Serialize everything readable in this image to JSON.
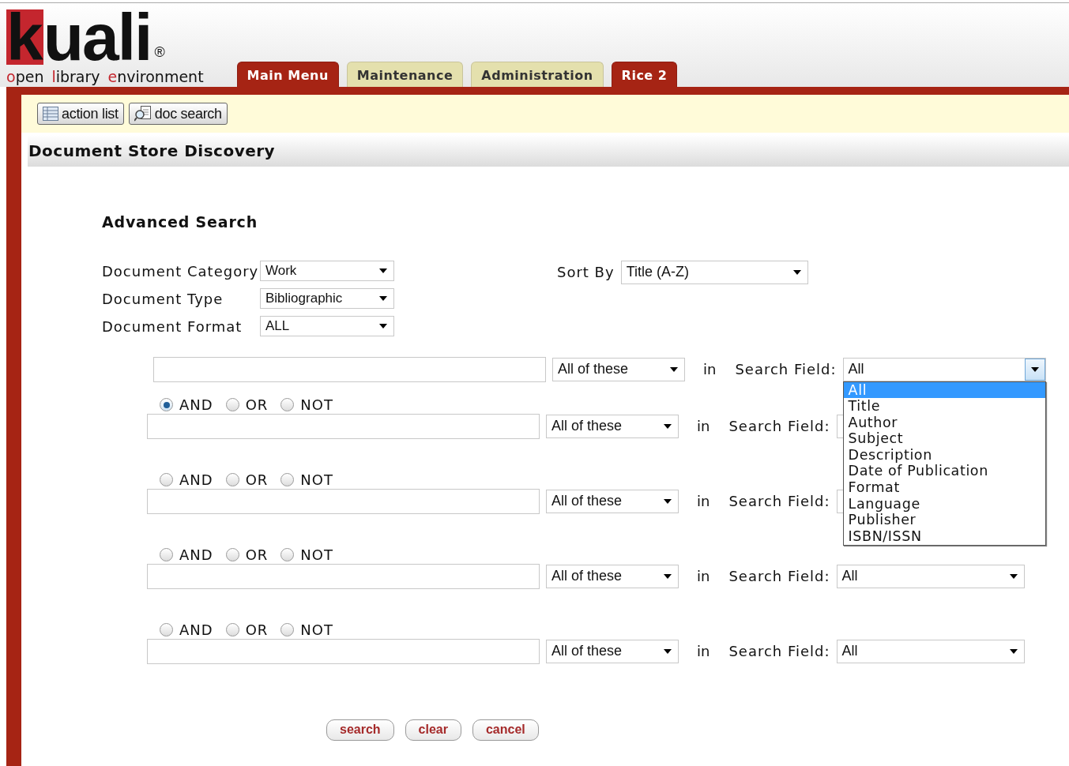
{
  "logo": {
    "text": "kuali",
    "mark": "®",
    "tagline": "open library environment"
  },
  "tabs": [
    {
      "label": "Main Menu",
      "selected": true
    },
    {
      "label": "Maintenance",
      "selected": false
    },
    {
      "label": "Administration",
      "selected": false
    },
    {
      "label": "Rice 2",
      "selected": true
    }
  ],
  "toolbar": [
    {
      "label": "action list",
      "kind": "list"
    },
    {
      "label": "doc search",
      "kind": "search"
    }
  ],
  "page_title": "Document Store Discovery",
  "section_title": "Advanced Search",
  "filters": [
    {
      "label": "Document Category",
      "value": "Work"
    },
    {
      "label": "Document Type",
      "value": "Bibliographic"
    },
    {
      "label": "Document Format",
      "value": "ALL"
    }
  ],
  "sort": {
    "label": "Sort By",
    "value": "Title (A-Z)"
  },
  "rows": [
    {
      "match": "All of these",
      "in": "in",
      "field_label": "Search Field:",
      "field_value": "All",
      "open": true
    },
    {
      "operators": [
        {
          "label": "AND",
          "selected": true
        },
        {
          "label": "OR",
          "selected": false
        },
        {
          "label": "NOT",
          "selected": false
        }
      ],
      "match": "All of these",
      "in": "in",
      "field_label": "Search Field:",
      "open": false
    },
    {
      "operators": [
        {
          "label": "AND",
          "selected": false
        },
        {
          "label": "OR",
          "selected": false
        },
        {
          "label": "NOT",
          "selected": false
        }
      ],
      "match": "All of these",
      "in": "in",
      "field_label": "Search Field:",
      "open": false
    },
    {
      "operators": [
        {
          "label": "AND",
          "selected": false
        },
        {
          "label": "OR",
          "selected": false
        },
        {
          "label": "NOT",
          "selected": false
        }
      ],
      "match": "All of these",
      "in": "in",
      "field_label": "Search Field:",
      "field_value": "All",
      "open": false
    },
    {
      "operators": [
        {
          "label": "AND",
          "selected": false
        },
        {
          "label": "OR",
          "selected": false
        },
        {
          "label": "NOT",
          "selected": false
        }
      ],
      "match": "All of these",
      "in": "in",
      "field_label": "Search Field:",
      "field_value": "All",
      "open": false
    }
  ],
  "field_options": [
    {
      "label": "All",
      "selected": true
    },
    {
      "label": "Title",
      "selected": false
    },
    {
      "label": "Author",
      "selected": false
    },
    {
      "label": "Subject",
      "selected": false
    },
    {
      "label": "Description",
      "selected": false
    },
    {
      "label": "Date of Publication",
      "selected": false
    },
    {
      "label": "Format",
      "selected": false
    },
    {
      "label": "Language",
      "selected": false
    },
    {
      "label": "Publisher",
      "selected": false
    },
    {
      "label": "ISBN/ISSN",
      "selected": false
    }
  ],
  "buttons": [
    "search",
    "clear",
    "cancel"
  ]
}
